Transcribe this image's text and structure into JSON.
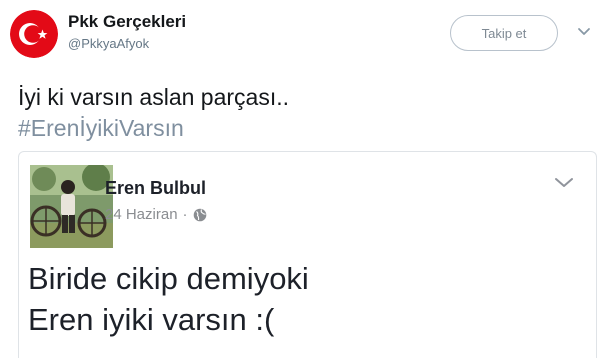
{
  "tweet": {
    "author": {
      "display_name": "Pkk Gerçekleri",
      "handle": "@PkkyaAfyok",
      "avatar_icon": "turkish-flag-icon",
      "avatar_color": "#e30a17"
    },
    "follow_label": "Takip et",
    "menu_icon": "chevron-down-icon",
    "text_line": "İyi ki varsın aslan parçası..",
    "hashtag": "#ErenİyikiVarsın",
    "hashtag_color": "#7f8f9f"
  },
  "embedded_post": {
    "author_name": "Eren Bulbul",
    "date": "24 Haziran",
    "separator": "·",
    "audience_icon": "globe-icon",
    "menu_icon": "chevron-down-icon",
    "post_lines": [
      "Biride cikip demiyoki",
      "Eren iyiki varsın :("
    ]
  }
}
